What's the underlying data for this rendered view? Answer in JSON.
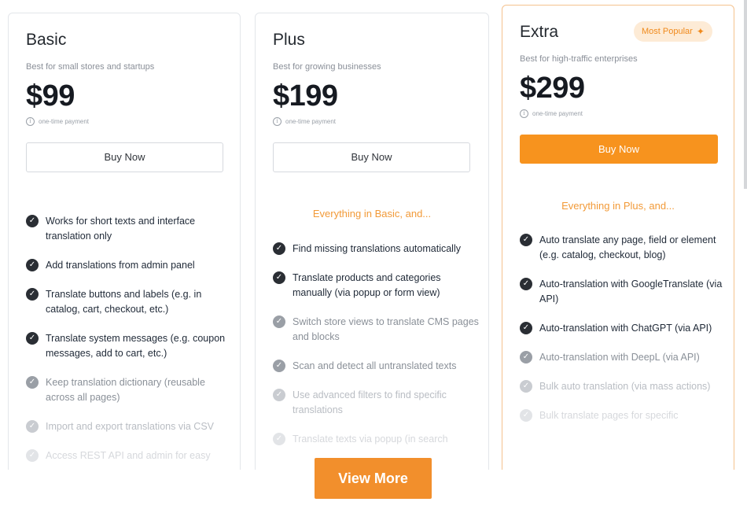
{
  "plans": [
    {
      "name": "Basic",
      "description": "Best for small stores and startups",
      "price": "$99",
      "payment_note": "one-time payment",
      "button": "Buy Now",
      "features": [
        "Works for short texts and interface translation only",
        "Add translations from admin panel",
        "Translate buttons and labels (e.g. in catalog, cart, checkout, etc.)",
        "Translate system messages (e.g. coupon messages, add to cart, etc.)",
        "Keep translation dictionary (reusable across all pages)",
        "Import and export translations via CSV",
        "Access REST API and admin for easy"
      ]
    },
    {
      "name": "Plus",
      "description": "Best for growing businesses",
      "price": "$199",
      "payment_note": "one-time payment",
      "button": "Buy Now",
      "intro": "Everything in Basic, and...",
      "features": [
        "Find missing translations automatically",
        "Translate products and categories manually (via popup or form view)",
        "Switch store views to translate CMS pages and blocks",
        "Scan and detect all untranslated texts",
        "Use advanced filters to find specific translations",
        "Translate texts via popup (in search"
      ]
    },
    {
      "name": "Extra",
      "badge": "Most Popular",
      "description": "Best for high-traffic enterprises",
      "price": "$299",
      "payment_note": "one-time payment",
      "button": "Buy Now",
      "intro": "Everything in Plus, and...",
      "features": [
        "Auto translate any page, field or element (e.g. catalog, checkout, blog)",
        "Auto-translation with GoogleTranslate (via API)",
        "Auto-translation with ChatGPT (via API)",
        "Auto-translation with DeepL (via API)",
        "Bulk auto translation (via mass actions)",
        "Bulk translate pages for specific"
      ]
    }
  ],
  "view_more": "View More",
  "colors": {
    "accent": "#f7931e",
    "badge_bg": "#fdebd6",
    "check": "#2a2e34"
  },
  "icons": {
    "check": "check-circle-icon",
    "info": "info-icon",
    "sparkle": "sparkle-icon"
  }
}
